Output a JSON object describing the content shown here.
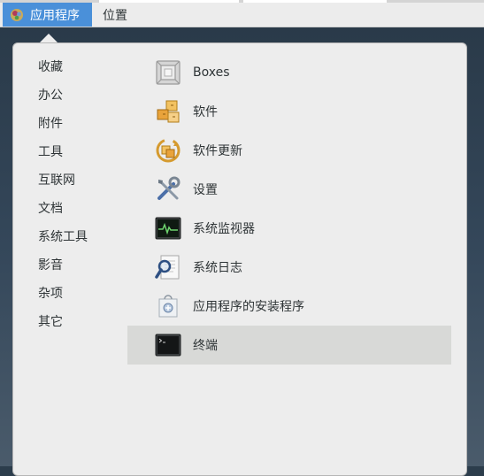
{
  "topbar": {
    "applications_label": "应用程序",
    "places_label": "位置"
  },
  "categories": [
    "收藏",
    "办公",
    "附件",
    "工具",
    "互联网",
    "文档",
    "系统工具",
    "影音",
    "杂项",
    "其它"
  ],
  "apps": [
    {
      "label": "Boxes",
      "icon": "boxes-icon"
    },
    {
      "label": "软件",
      "icon": "software-icon"
    },
    {
      "label": "软件更新",
      "icon": "software-update-icon"
    },
    {
      "label": "设置",
      "icon": "settings-icon"
    },
    {
      "label": "系统监视器",
      "icon": "system-monitor-icon"
    },
    {
      "label": "系统日志",
      "icon": "system-log-icon"
    },
    {
      "label": "应用程序的安装程序",
      "icon": "app-installer-icon"
    },
    {
      "label": "终端",
      "icon": "terminal-icon",
      "selected": true
    }
  ],
  "colors": {
    "accent": "#4a90d9",
    "panel": "#ededed",
    "selected_row": "#d8d9d7",
    "text": "#2e3436"
  }
}
